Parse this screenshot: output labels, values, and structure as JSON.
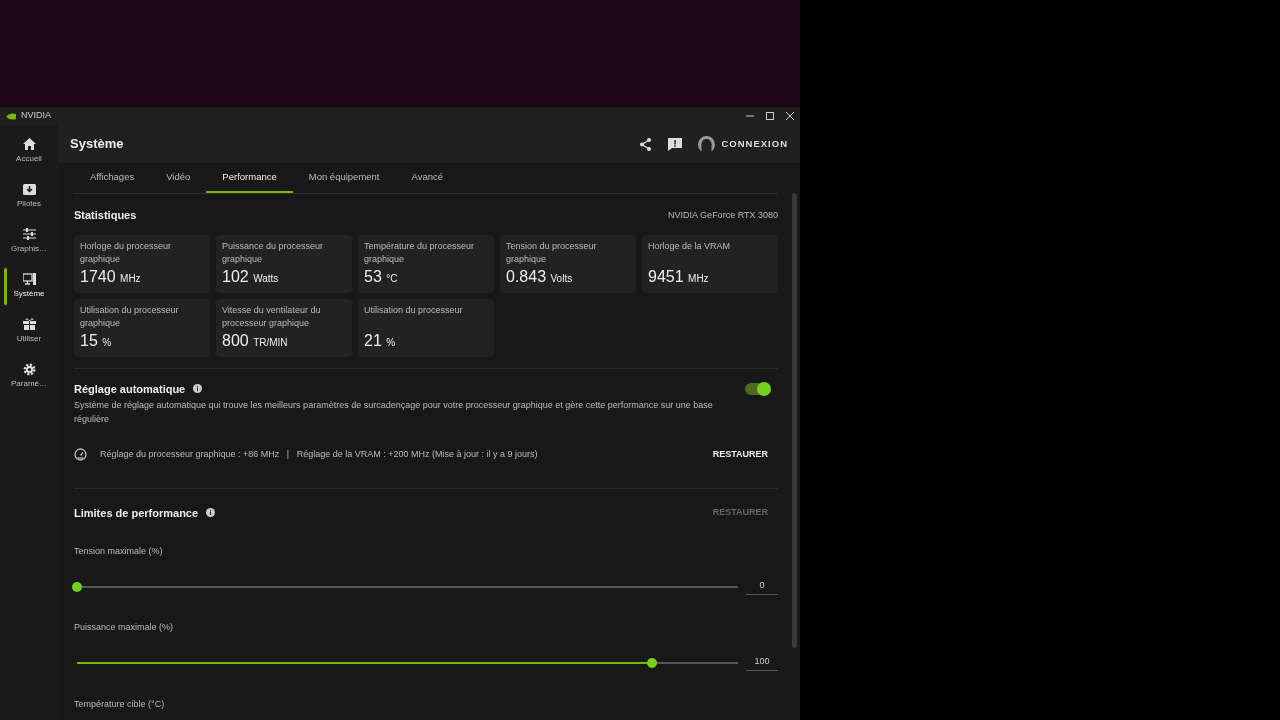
{
  "window": {
    "title": "NVIDIA"
  },
  "sidebar": {
    "items": [
      {
        "label": "Accueil",
        "kind": "home",
        "selected": false
      },
      {
        "label": "Pilotes",
        "kind": "download",
        "selected": false
      },
      {
        "label": "Graphis…",
        "kind": "sliders",
        "selected": false
      },
      {
        "label": "Système",
        "kind": "system",
        "selected": true
      },
      {
        "label": "Utiliser",
        "kind": "gift",
        "selected": false
      },
      {
        "label": "Paramè…",
        "kind": "gear",
        "selected": false
      }
    ]
  },
  "header": {
    "title": "Système",
    "login": "CONNEXION"
  },
  "tabs": [
    {
      "label": "Affichages",
      "selected": false
    },
    {
      "label": "Vidéo",
      "selected": false
    },
    {
      "label": "Performance",
      "selected": true
    },
    {
      "label": "Mon équipement",
      "selected": false
    },
    {
      "label": "Avancé",
      "selected": false
    }
  ],
  "statistics": {
    "title": "Statistiques",
    "gpu": "NVIDIA GeForce RTX 3080",
    "cards": [
      {
        "label": "Horloge du processeur graphique",
        "value": "1740",
        "unit": "MHz"
      },
      {
        "label": "Puissance du processeur graphique",
        "value": "102",
        "unit": "Watts"
      },
      {
        "label": "Température du processeur graphique",
        "value": "53",
        "unit": "°C"
      },
      {
        "label": "Tension du processeur graphique",
        "value": "0.843",
        "unit": "Volts"
      },
      {
        "label": "Horloge de la VRAM",
        "value": "9451",
        "unit": "MHz"
      },
      {
        "label": "Utilisation du processeur graphique",
        "value": "15",
        "unit": "%"
      },
      {
        "label": "Vitesse du ventilateur du processeur graphique",
        "value": "800",
        "unit": "TR/MIN"
      },
      {
        "label": "Utilisation du processeur",
        "value": "21",
        "unit": "%"
      }
    ]
  },
  "auto_tuning": {
    "title": "Réglage automatique",
    "on": true,
    "description": "Système de réglage automatique qui trouve les meilleurs paramètres de surcadençage pour votre processeur graphique et gère cette performance sur une base régulière",
    "status": "Réglage du processeur graphique : +86 MHz   |   Réglage de la VRAM : +200 MHz (Mise à jour : il y a 9 jours)",
    "restore": {
      "label": "RESTAURER",
      "disabled": false
    }
  },
  "limits": {
    "title": "Limites de performance",
    "restore": {
      "label": "RESTAURER",
      "disabled": true
    },
    "sliders": [
      {
        "label": "Tension maximale (%)",
        "level": 0,
        "reading": "0"
      },
      {
        "label": "Puissance maximale (%)",
        "level": 0.87,
        "reading": "100"
      }
    ],
    "next_label": "Température cible (°C)"
  }
}
